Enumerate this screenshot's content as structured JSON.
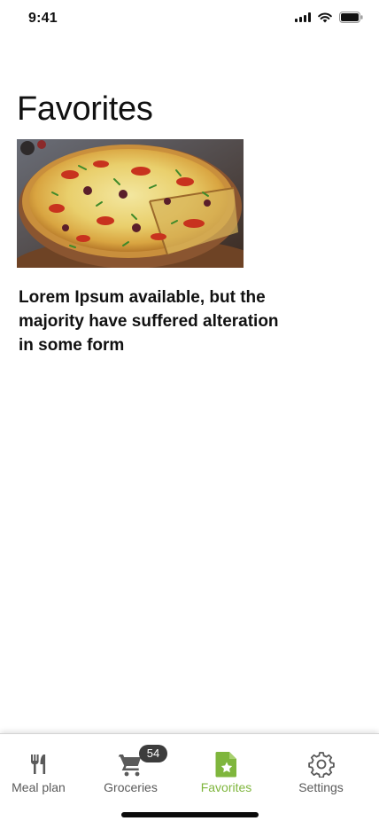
{
  "status_bar": {
    "time": "9:41"
  },
  "page": {
    "title": "Favorites"
  },
  "favorites": [
    {
      "image_icon": "pizza-photo",
      "title": "Lorem Ipsum available, but the majority have suffered alteration in some form"
    }
  ],
  "tab_bar": {
    "tabs": [
      {
        "label": "Meal plan",
        "icon": "fork-knife-icon",
        "active": false
      },
      {
        "label": "Groceries",
        "icon": "cart-icon",
        "active": false,
        "badge": "54"
      },
      {
        "label": "Favorites",
        "icon": "favorite-file-icon",
        "active": true
      },
      {
        "label": "Settings",
        "icon": "gear-icon",
        "active": false
      }
    ]
  },
  "colors": {
    "accent": "#7fb63d",
    "inactive": "#5a5a5a",
    "badge_bg": "#3c3c3c"
  }
}
